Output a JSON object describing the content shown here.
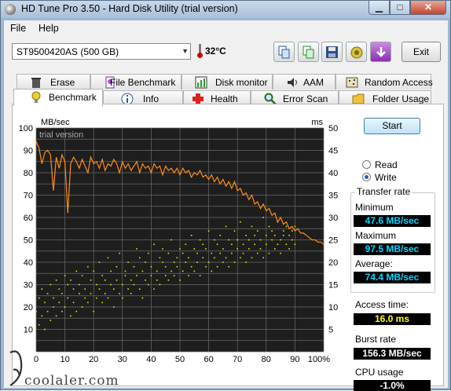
{
  "window": {
    "title": "HD Tune Pro 3.50 - Hard Disk Utility (trial version)",
    "min_glyph": "▁",
    "max_glyph": "□",
    "close_glyph": "✕"
  },
  "menu": {
    "file": "File",
    "help": "Help"
  },
  "toolbar": {
    "drive": "ST9500420AS (500 GB)",
    "temperature": "32°C",
    "exit_label": "Exit",
    "icons": [
      "copy-icon",
      "copy-all-icon",
      "save-icon",
      "screenshot-icon",
      "download-icon"
    ]
  },
  "tabs": {
    "row1": [
      "Erase",
      "File Benchmark",
      "Disk monitor",
      "AAM",
      "Random Access"
    ],
    "row2": [
      "Benchmark",
      "Info",
      "Health",
      "Error Scan",
      "Folder Usage"
    ],
    "active": "Benchmark"
  },
  "controls": {
    "start_label": "Start",
    "read_label": "Read",
    "write_label": "Write",
    "selected_mode": "Write"
  },
  "results": {
    "transfer_rate_label": "Transfer rate",
    "minimum_label": "Minimum",
    "minimum": "47.6 MB/sec",
    "maximum_label": "Maximum",
    "maximum": "97.5 MB/sec",
    "average_label": "Average:",
    "average": "74.4 MB/sec",
    "access_time_label": "Access time:",
    "access_time": "16.0 ms",
    "burst_rate_label": "Burst rate",
    "burst_rate": "156.3 MB/sec",
    "cpu_usage_label": "CPU usage",
    "cpu_usage": "-1.0%"
  },
  "watermark": "coolaler.com",
  "chart_data": {
    "type": "line",
    "watermark_text": "trial version",
    "y_left_label": "MB/sec",
    "y_right_label": "ms",
    "y_left_ticks": [
      "100",
      "90",
      "80",
      "70",
      "60",
      "50",
      "40",
      "30",
      "20",
      "10"
    ],
    "y_right_ticks": [
      "50",
      "45",
      "40",
      "35",
      "30",
      "25",
      "20",
      "15",
      "10",
      "5"
    ],
    "x_ticks": [
      "0",
      "10",
      "20",
      "30",
      "40",
      "50",
      "60",
      "70",
      "80",
      "90",
      "100%"
    ],
    "ylim_left": [
      0,
      100
    ],
    "ylim_right": [
      0,
      50
    ],
    "xlim": [
      0,
      100
    ],
    "grid": true,
    "colors": {
      "background": "#1e1e1e",
      "grid": "#6a6a6a",
      "transfer": "#ff8c1a",
      "access": "#e6e600"
    },
    "series": [
      {
        "kind": "transfer",
        "axis": "left",
        "x": [
          0,
          1,
          2,
          3,
          4,
          5,
          6,
          7,
          8,
          9,
          10,
          11,
          12,
          13,
          14,
          15,
          16,
          17,
          18,
          19,
          20,
          21,
          22,
          23,
          24,
          25,
          26,
          27,
          28,
          29,
          30,
          31,
          32,
          33,
          34,
          35,
          36,
          37,
          38,
          39,
          40,
          41,
          42,
          43,
          44,
          45,
          46,
          47,
          48,
          49,
          50,
          51,
          52,
          53,
          54,
          55,
          56,
          57,
          58,
          59,
          60,
          61,
          62,
          63,
          64,
          65,
          66,
          67,
          68,
          69,
          70,
          71,
          72,
          73,
          74,
          75,
          76,
          77,
          78,
          79,
          80,
          81,
          82,
          83,
          84,
          85,
          86,
          87,
          88,
          89,
          90,
          91,
          92,
          93,
          94,
          95,
          96,
          97,
          98,
          99,
          100
        ],
        "values": [
          94,
          91,
          84,
          89,
          90,
          88,
          72,
          87,
          82,
          88,
          85,
          62,
          84,
          87,
          85,
          82,
          86,
          83,
          80,
          87,
          84,
          85,
          82,
          86,
          81,
          84,
          83,
          86,
          84,
          80,
          85,
          82,
          84,
          81,
          83,
          85,
          80,
          84,
          82,
          83,
          80,
          84,
          82,
          83,
          79,
          83,
          81,
          82,
          80,
          82,
          79,
          82,
          80,
          81,
          78,
          80,
          79,
          81,
          78,
          79,
          77,
          79,
          76,
          78,
          75,
          77,
          74,
          76,
          73,
          76,
          72,
          73,
          70,
          71,
          68,
          70,
          66,
          67,
          64,
          66,
          63,
          64,
          61,
          62,
          58,
          60,
          57,
          58,
          55,
          56,
          54,
          55,
          53,
          53,
          52,
          51,
          50,
          50,
          49,
          49,
          48
        ]
      },
      {
        "kind": "access",
        "axis": "right",
        "note": "scatter of access time samples, ms",
        "x": [
          0,
          1,
          1,
          2,
          2,
          3,
          3,
          4,
          4,
          5,
          5,
          6,
          6,
          7,
          7,
          8,
          8,
          9,
          9,
          10,
          10,
          11,
          11,
          12,
          12,
          13,
          13,
          14,
          14,
          15,
          15,
          16,
          16,
          17,
          17,
          18,
          18,
          19,
          19,
          20,
          20,
          21,
          21,
          22,
          22,
          23,
          23,
          24,
          24,
          25,
          25,
          26,
          26,
          27,
          27,
          28,
          28,
          29,
          29,
          30,
          30,
          31,
          31,
          32,
          32,
          33,
          33,
          34,
          34,
          35,
          35,
          36,
          36,
          37,
          37,
          38,
          38,
          39,
          39,
          40,
          40,
          41,
          41,
          42,
          42,
          43,
          43,
          44,
          44,
          45,
          45,
          46,
          46,
          47,
          47,
          48,
          48,
          49,
          49,
          50,
          50,
          51,
          51,
          52,
          52,
          53,
          53,
          54,
          54,
          55,
          55,
          56,
          56,
          57,
          57,
          58,
          58,
          59,
          59,
          60,
          60,
          61,
          61,
          62,
          62,
          63,
          63,
          64,
          64,
          65,
          65,
          66,
          66,
          67,
          67,
          68,
          68,
          69,
          69,
          70,
          70,
          71,
          71,
          72,
          72,
          73,
          73,
          74,
          74,
          75,
          75,
          76,
          76,
          77,
          77,
          78,
          78,
          79,
          79,
          80,
          80,
          81,
          81,
          82,
          82,
          83,
          83,
          84,
          84,
          85,
          85,
          86,
          86,
          87,
          87,
          88,
          88,
          89,
          89,
          90,
          90
        ],
        "values": [
          9,
          12,
          6,
          14,
          8,
          11,
          5,
          13,
          9,
          15,
          7,
          12,
          10,
          16,
          8,
          14,
          11,
          9,
          13,
          17,
          10,
          15,
          12,
          8,
          16,
          11,
          14,
          18,
          9,
          13,
          15,
          10,
          17,
          12,
          14,
          19,
          11,
          16,
          13,
          9,
          18,
          15,
          12,
          20,
          14,
          11,
          17,
          13,
          16,
          21,
          12,
          15,
          18,
          14,
          10,
          19,
          16,
          13,
          22,
          15,
          12,
          18,
          17,
          14,
          20,
          16,
          13,
          19,
          15,
          23,
          17,
          14,
          21,
          18,
          12,
          16,
          20,
          15,
          22,
          17,
          19,
          14,
          24,
          18,
          16,
          21,
          15,
          20,
          23,
          17,
          19,
          16,
          22,
          18,
          25,
          20,
          17,
          21,
          19,
          23,
          16,
          22,
          18,
          24,
          20,
          17,
          21,
          26,
          19,
          23,
          18,
          22,
          20,
          25,
          17,
          24,
          21,
          19,
          23,
          27,
          20,
          22,
          18,
          25,
          21,
          24,
          19,
          26,
          22,
          20,
          23,
          28,
          21,
          25,
          19,
          24,
          22,
          27,
          20,
          23,
          25,
          21,
          29,
          24,
          22,
          26,
          20,
          25,
          23,
          28,
          21,
          26,
          24,
          22,
          27,
          25,
          23,
          30,
          21,
          26,
          24,
          28,
          22,
          25,
          27,
          23,
          26,
          24,
          29,
          25,
          22,
          27,
          26,
          24,
          28,
          23,
          26,
          25,
          27,
          24,
          28
        ]
      }
    ]
  }
}
